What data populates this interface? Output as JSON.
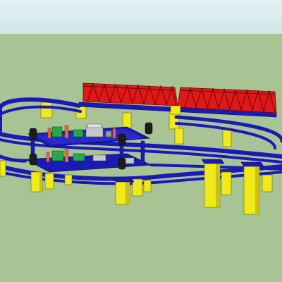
{
  "scene": {
    "colors": {
      "sky": "#d6ebec",
      "ground": "#a9c494",
      "track": "#1a1ab6",
      "track_dark": "#0c0c78",
      "truss": "#e01818",
      "truss_dark": "#8c0c0c",
      "pier": "#f0ea1a",
      "pier_shade": "#c9c20e",
      "deck": "#9aa0a8",
      "board_green": "#27a84a",
      "board_orange": "#e96a3c",
      "board_gray": "#c7c7c7",
      "signal": "#1c1c1c"
    },
    "objects": {
      "upper_track": "upper-oval-track",
      "lower_track": "lower-oval-track",
      "bridge": "truss-bridge",
      "supports": "support-piers",
      "equipment": "control-boards",
      "signals": "signal-lamps"
    }
  }
}
